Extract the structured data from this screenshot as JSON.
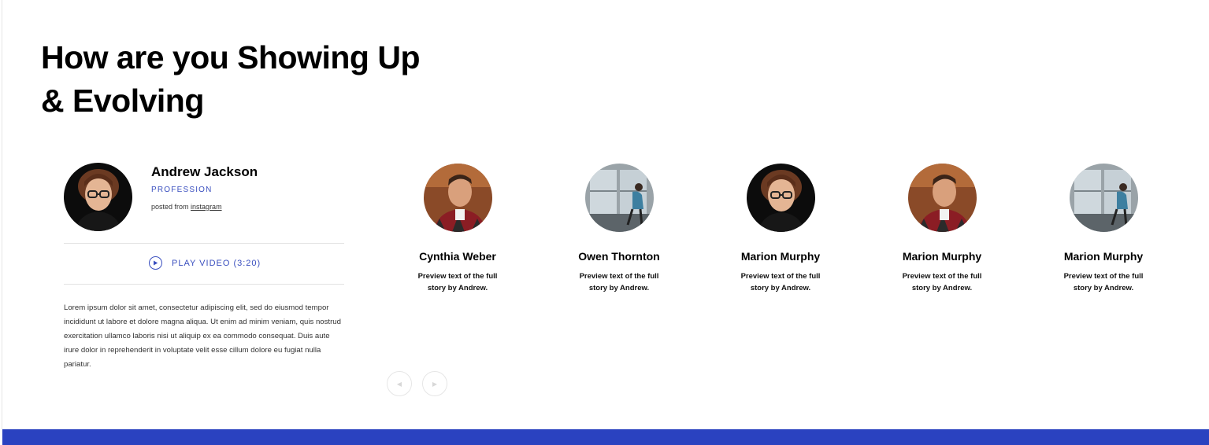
{
  "section": {
    "title_line1": "How are you Showing Up",
    "title_line2": "& Evolving"
  },
  "featured": {
    "name": "Andrew Jackson",
    "profession": "PROFESSION",
    "posted_prefix": "posted from",
    "posted_source": "instagram",
    "play_label": "PLAY VIDEO (3:20)",
    "description": "Lorem ipsum dolor sit amet, consectetur adipiscing elit, sed do eiusmod tempor incididunt ut labore et dolore magna aliqua. Ut enim ad minim veniam, quis nostrud exercitation ullamco laboris nisi ut aliquip ex ea commodo consequat. Duis aute irure dolor in reprehenderit in voluptate velit esse cillum dolore eu fugiat nulla pariatur."
  },
  "stories": [
    {
      "name": "Cynthia Weber",
      "preview": "Preview text of the full story by Andrew.",
      "photo": "man-plaid-shirt"
    },
    {
      "name": "Owen Thornton",
      "preview": "Preview text of the full story by Andrew.",
      "photo": "woman-at-window"
    },
    {
      "name": "Marion Murphy",
      "preview": "Preview text of the full story by Andrew.",
      "photo": "person-glasses-dark"
    },
    {
      "name": "Marion Murphy",
      "preview": "Preview text of the full story by Andrew.",
      "photo": "man-plaid-shirt"
    },
    {
      "name": "Marion Murphy",
      "preview": "Preview text of the full story by Andrew.",
      "photo": "woman-at-window"
    }
  ],
  "carousel": {
    "prev_icon": "triangle-left-icon",
    "next_icon": "triangle-right-icon"
  },
  "colors": {
    "accent": "#3a4fbf",
    "footer_bar": "#2a42c0"
  }
}
